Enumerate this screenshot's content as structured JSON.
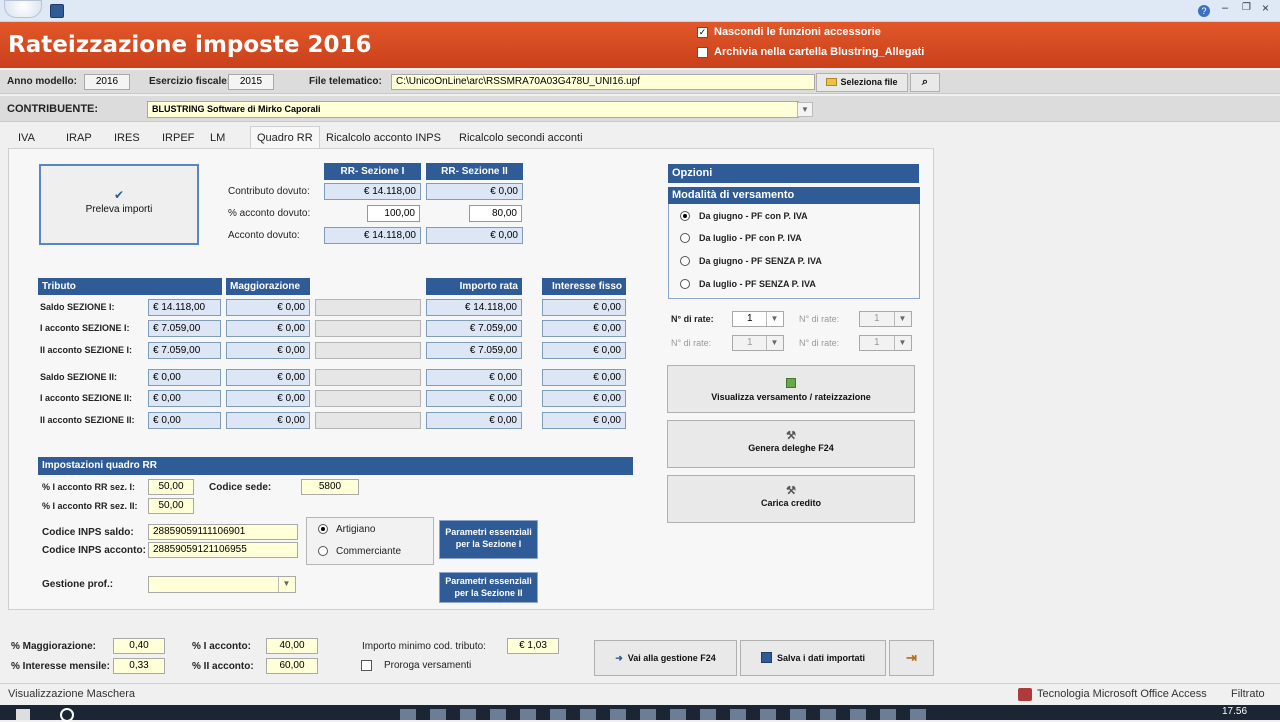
{
  "header": {
    "title": "Rateizzazione imposte 2016",
    "chk1": "Nascondi le funzioni accessorie",
    "chk2": "Archivia nella cartella Blustring_Allegati"
  },
  "top": {
    "anno_label": "Anno modello:",
    "anno": "2016",
    "eserc_label": "Esercizio fiscale:",
    "eserc": "2015",
    "file_label": "File telematico:",
    "file": "C:\\UnicoOnLine\\arc\\RSSMRA70A03G478U_UNI16.upf",
    "select_btn": "Seleziona file"
  },
  "contrib": {
    "label": "CONTRIBUENTE:",
    "value": "BLUSTRING Software di Mirko Caporali"
  },
  "tabs": [
    "IVA",
    "IRAP",
    "IRES",
    "IRPEF",
    "LM",
    "Quadro RR",
    "Ricalcolo acconto INPS",
    "Ricalcolo secondi acconti"
  ],
  "preleva": "Preleva importi",
  "rr": {
    "h1": "RR- Sezione I",
    "h2": "RR- Sezione II",
    "r1": "Contributo dovuto:",
    "r2": "% acconto dovuto:",
    "r3": "Acconto dovuto:",
    "v11": "€ 14.118,00",
    "v12": "€ 0,00",
    "v21": "100,00",
    "v22": "80,00",
    "v31": "€ 14.118,00",
    "v32": "€ 0,00"
  },
  "grid": {
    "h_tributo": "Tributo",
    "h_magg": "Maggiorazione",
    "h_imp": "Importo rata",
    "h_int": "Interesse fisso",
    "rows": [
      {
        "label": "Saldo SEZIONE I:",
        "a": "€ 14.118,00",
        "b": "€ 0,00",
        "c": "€ 14.118,00",
        "d": "€ 0,00"
      },
      {
        "label": "I acconto SEZIONE I:",
        "a": "€ 7.059,00",
        "b": "€ 0,00",
        "c": "€ 7.059,00",
        "d": "€ 0,00"
      },
      {
        "label": "II acconto SEZIONE I:",
        "a": "€ 7.059,00",
        "b": "€ 0,00",
        "c": "€ 7.059,00",
        "d": "€ 0,00"
      },
      {
        "label": "Saldo SEZIONE II:",
        "a": "€ 0,00",
        "b": "€ 0,00",
        "c": "€ 0,00",
        "d": "€ 0,00"
      },
      {
        "label": "I acconto SEZIONE II:",
        "a": "€ 0,00",
        "b": "€ 0,00",
        "c": "€ 0,00",
        "d": "€ 0,00"
      },
      {
        "label": "II acconto SEZIONE II:",
        "a": "€ 0,00",
        "b": "€ 0,00",
        "c": "€ 0,00",
        "d": "€ 0,00"
      }
    ]
  },
  "imp": {
    "title": "Impostazioni quadro RR",
    "l1": "% I acconto RR sez. I:",
    "v1": "50,00",
    "l2": "% I acconto RR sez. II:",
    "v2": "50,00",
    "sede_label": "Codice sede:",
    "sede": "5800",
    "inps_saldo_label": "Codice INPS saldo:",
    "inps_saldo": "28859059111106901",
    "inps_acc_label": "Codice INPS acconto:",
    "inps_acc": "28859059121106955",
    "r1": "Artigiano",
    "r2": "Commerciante",
    "btn1": "Parametri essenziali per la Sezione I",
    "btn2": "Parametri essenziali per la Sezione II",
    "gest_label": "Gestione prof.:"
  },
  "opz": {
    "title": "Opzioni",
    "mod_title": "Modalità di versamento",
    "radios": [
      "Da giugno - PF con P. IVA",
      "Da luglio - PF con P. IVA",
      "Da giugno - PF SENZA P. IVA",
      "Da luglio - PF SENZA P. IVA"
    ],
    "rate_label": "N° di rate:",
    "rate": "1",
    "btn_vis": "Visualizza versamento / rateizzazione",
    "btn_gen": "Genera deleghe F24",
    "btn_car": "Carica credito"
  },
  "bottom": {
    "magg_label": "% Maggiorazione:",
    "magg": "0,40",
    "int_label": "% Interesse mensile:",
    "int": "0,33",
    "iacc_label": "% I acconto:",
    "iacc": "40,00",
    "iiacc_label": "% II acconto:",
    "iiacc": "60,00",
    "min_label": "Importo minimo cod. tributo:",
    "min": "€ 1,03",
    "proroga": "Proroga versamenti",
    "btn_f24": "Vai alla gestione F24",
    "btn_salva": "Salva i dati importati"
  },
  "status": {
    "left": "Visualizzazione Maschera",
    "right1": "Tecnologia Microsoft Office Access",
    "right2": "Filtrato"
  },
  "clock": "17.56",
  "colors": {
    "header": "#d94a20",
    "accent": "#2f5b96"
  }
}
